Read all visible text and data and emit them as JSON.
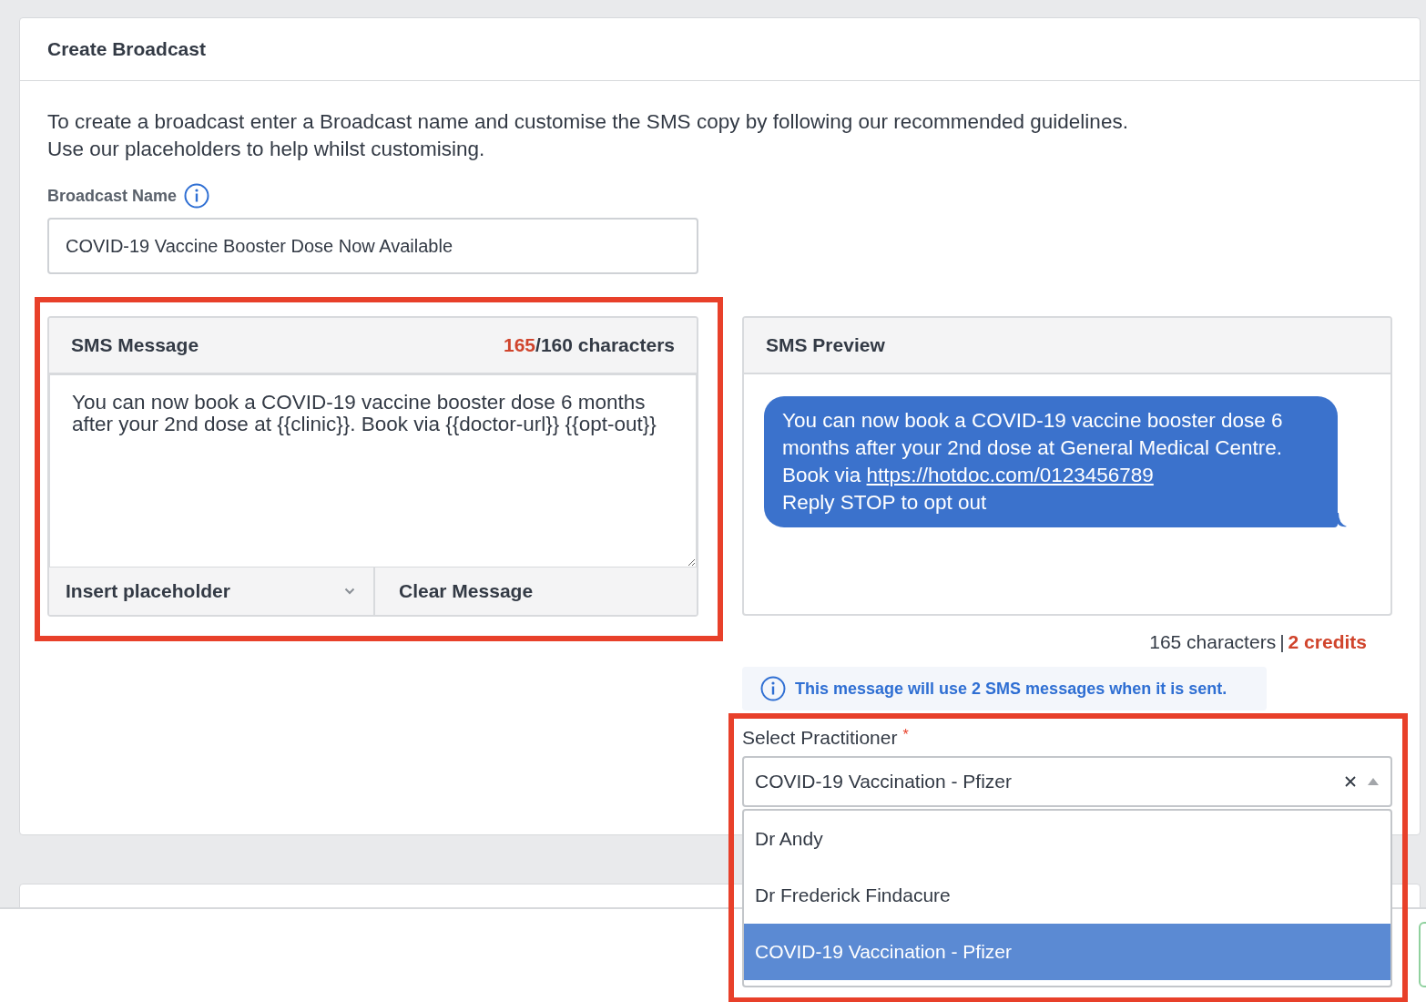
{
  "card": {
    "title": "Create Broadcast",
    "intro": [
      "To create a broadcast enter a Broadcast name and customise the SMS copy by following our recommended guidelines.",
      "Use our placeholders to help whilst customising."
    ]
  },
  "broadcast_name": {
    "label": "Broadcast Name",
    "value": "COVID-19 Vaccine Booster Dose Now Available"
  },
  "sms_message": {
    "title": "SMS Message",
    "count": "165",
    "limit": "/160 characters",
    "over_limit": true,
    "text": "You can now book a COVID-19 vaccine booster dose 6 months after your 2nd dose at {{clinic}}. Book via {{doctor-url}} {{opt-out}}",
    "insert_placeholder": "Insert placeholder",
    "clear": "Clear Message"
  },
  "sms_preview": {
    "title": "SMS Preview",
    "text": "You can now book a COVID-19 vaccine booster dose 6 months after your 2nd dose at General Medical Centre. Book via ",
    "link": "https://hotdoc.com/0123456789",
    "text_after": "Reply STOP to opt out"
  },
  "summary": {
    "characters": "165 characters",
    "separator": "|",
    "credits": "2 credits"
  },
  "notice": "This message will use 2 SMS messages when it is sent.",
  "practitioner": {
    "label": "Select Practitioner",
    "required_mark": "*",
    "value": "COVID-19 Vaccination - Pfizer",
    "expanded": true,
    "options": [
      {
        "label": "Dr Andy",
        "selected": false
      },
      {
        "label": "Dr Frederick Findacure",
        "selected": false
      },
      {
        "label": "COVID-19 Vaccination - Pfizer",
        "selected": true
      }
    ]
  }
}
